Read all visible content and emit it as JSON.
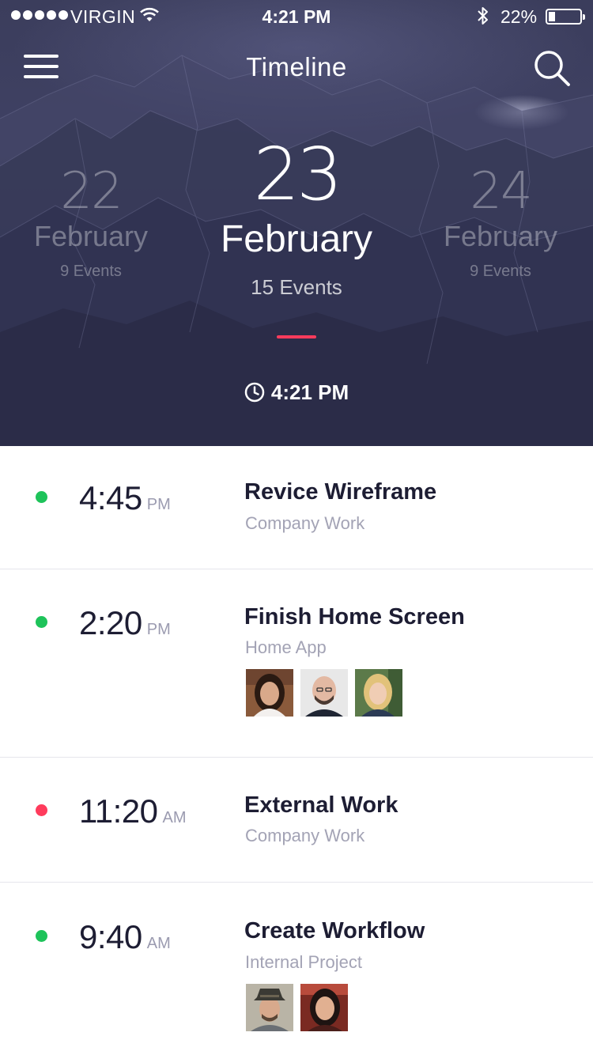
{
  "status_bar": {
    "carrier": "VIRGIN",
    "time": "4:21 PM",
    "battery": "22%",
    "battery_level": 0.22
  },
  "nav": {
    "title": "Timeline",
    "menu_icon": "hamburger-menu-icon",
    "search_icon": "search-icon"
  },
  "dates": {
    "prev": {
      "day": "22",
      "month": "February",
      "events": "9 Events"
    },
    "current": {
      "day": "23",
      "month": "February",
      "events": "15 Events"
    },
    "next": {
      "day": "24",
      "month": "February",
      "events": "9 Events"
    }
  },
  "current_time": "4:21 PM",
  "colors": {
    "accent": "#ff3b5c",
    "status_green": "#1ec35a",
    "status_red": "#ff3b5c",
    "header_bg": "#3b3d5c"
  },
  "events": [
    {
      "time": "4:45",
      "ampm": "PM",
      "title": "Revice Wireframe",
      "category": "Company Work",
      "status": "green"
    },
    {
      "time": "2:20",
      "ampm": "PM",
      "title": "Finish Home Screen",
      "category": "Home App",
      "status": "green"
    },
    {
      "time": "11:20",
      "ampm": "AM",
      "title": "External Work",
      "category": "Company Work",
      "status": "red"
    },
    {
      "time": "9:40",
      "ampm": "AM",
      "title": "Create Workflow",
      "category": "Internal Project",
      "status": "green"
    }
  ]
}
